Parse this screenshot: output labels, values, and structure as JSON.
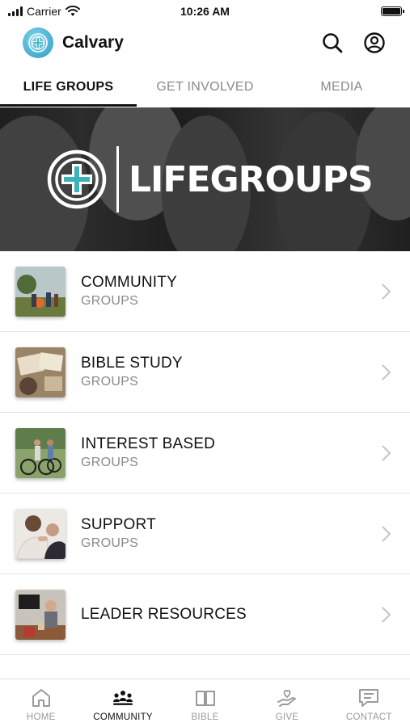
{
  "status_bar": {
    "carrier": "Carrier",
    "time": "10:26 AM"
  },
  "header": {
    "title": "Calvary",
    "logo_icon": "calvary-cross-logo",
    "search_icon": "search-icon",
    "profile_icon": "user-icon"
  },
  "tabs": [
    {
      "label": "LIFE GROUPS",
      "active": true
    },
    {
      "label": "GET INVOLVED",
      "active": false
    },
    {
      "label": "MEDIA",
      "active": false
    }
  ],
  "hero": {
    "text": "LIFEGROUPS"
  },
  "list": [
    {
      "title": "COMMUNITY",
      "subtitle": "GROUPS"
    },
    {
      "title": "BIBLE STUDY",
      "subtitle": "GROUPS"
    },
    {
      "title": "INTEREST BASED",
      "subtitle": "GROUPS"
    },
    {
      "title": "SUPPORT",
      "subtitle": "GROUPS"
    },
    {
      "title": "LEADER RESOURCES",
      "subtitle": ""
    }
  ],
  "bottom_nav": [
    {
      "label": "HOME",
      "icon": "home-icon",
      "active": false
    },
    {
      "label": "COMMUNITY",
      "icon": "community-icon",
      "active": true
    },
    {
      "label": "BIBLE",
      "icon": "book-icon",
      "active": false
    },
    {
      "label": "GIVE",
      "icon": "give-icon",
      "active": false
    },
    {
      "label": "CONTACT",
      "icon": "message-icon",
      "active": false
    }
  ],
  "colors": {
    "accent": "#2a9cc6",
    "logo_teal": "#3bb3b8",
    "inactive": "#8a8a8a"
  }
}
